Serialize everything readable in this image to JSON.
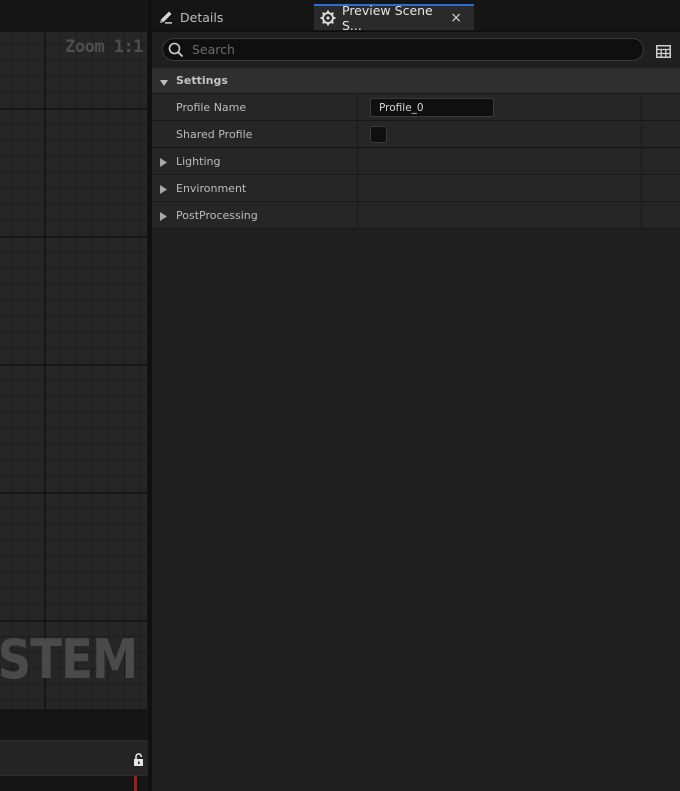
{
  "graph": {
    "zoom_label": "Zoom 1:1",
    "watermark": "STEM"
  },
  "tabs": {
    "details_label": "Details",
    "preview_label": "Preview Scene S...",
    "close_glyph": "×"
  },
  "search": {
    "placeholder": "Search",
    "value": ""
  },
  "settings": {
    "category_label": "Settings",
    "profile_name_label": "Profile Name",
    "profile_name_value": "Profile_0",
    "shared_profile_label": "Shared Profile",
    "shared_profile_checked": false,
    "lighting_label": "Lighting",
    "environment_label": "Environment",
    "postprocessing_label": "PostProcessing"
  },
  "colors": {
    "accent": "#2a6fd0",
    "panel_bg": "#1f1f1f",
    "row_bg": "#262626",
    "category_bg": "#2f2f2f",
    "marker_red": "#9b1c1c"
  },
  "icons": {
    "details_tab": "pencil-icon",
    "preview_tab": "gear-icon",
    "search": "search-icon",
    "view_options": "grid-view-icon",
    "lock": "unlock-icon",
    "expand": "triangle-right-icon",
    "collapse": "triangle-down-icon"
  }
}
